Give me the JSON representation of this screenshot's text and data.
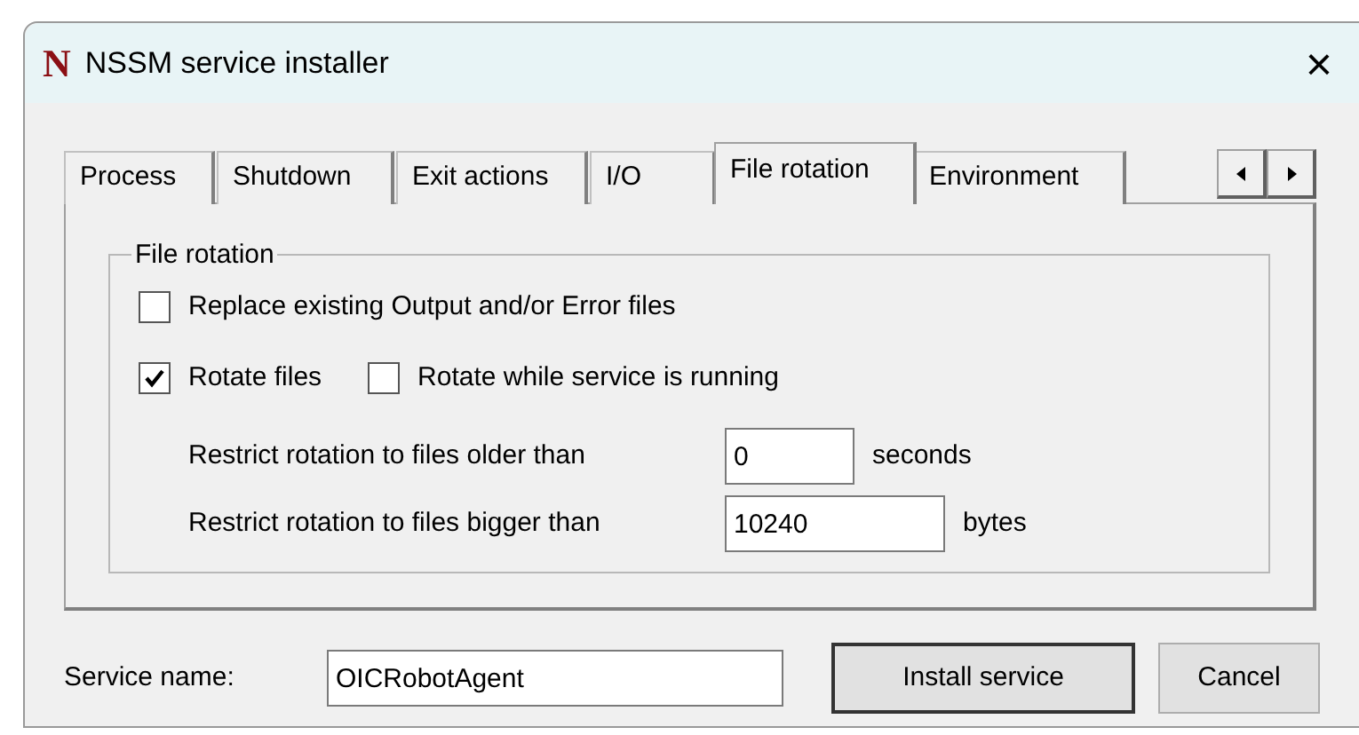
{
  "window": {
    "title": "NSSM service installer",
    "icon": "N",
    "close": "×"
  },
  "tabs": [
    {
      "label": "Process",
      "selected": false
    },
    {
      "label": "Shutdown",
      "selected": false
    },
    {
      "label": "Exit actions",
      "selected": false
    },
    {
      "label": "I/O",
      "selected": false
    },
    {
      "label": "File rotation",
      "selected": true
    },
    {
      "label": "Environment",
      "selected": false
    }
  ],
  "group": {
    "title": "File rotation",
    "replace": {
      "label": "Replace existing Output and/or Error files",
      "checked": false
    },
    "rotate": {
      "label": "Rotate files",
      "checked": true
    },
    "rotate_online": {
      "label": "Rotate while service is running",
      "checked": false
    },
    "fields": [
      {
        "label": "Restrict rotation to files older than",
        "value": "0",
        "unit": "seconds"
      },
      {
        "label": "Restrict rotation to files bigger than",
        "value": "10240",
        "unit": "bytes"
      }
    ]
  },
  "service_name": {
    "label": "Service name:",
    "value": "OICRobotAgent"
  },
  "buttons": [
    {
      "label": "Install service",
      "default": true
    },
    {
      "label": "Cancel",
      "default": false
    }
  ]
}
